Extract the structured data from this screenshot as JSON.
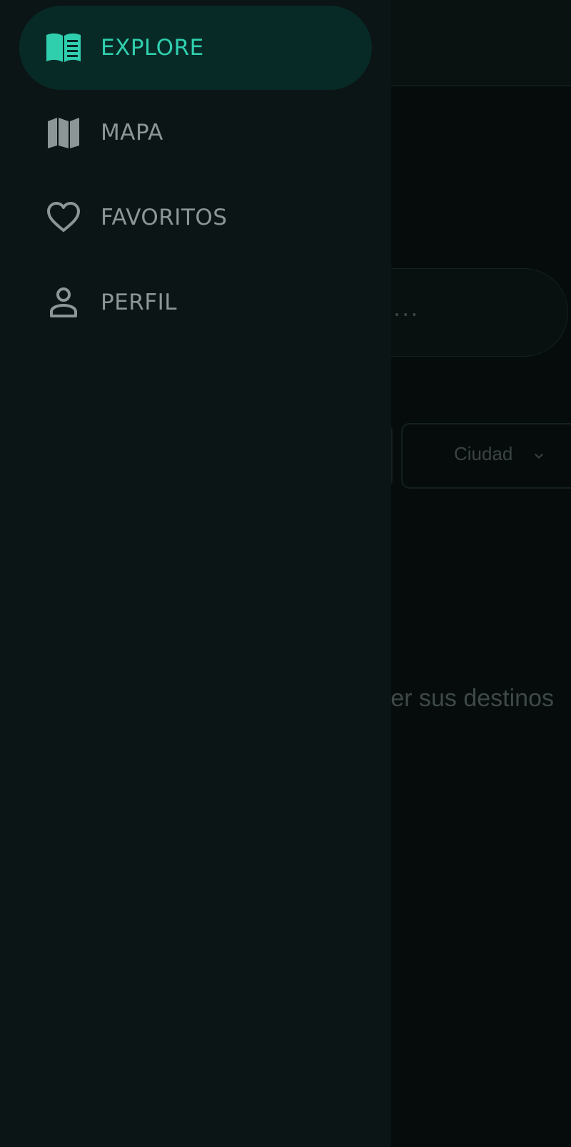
{
  "drawer": {
    "items": [
      {
        "label": "EXPLORE",
        "icon": "book-open-icon",
        "active": true
      },
      {
        "label": "MAPA",
        "icon": "map-icon",
        "active": false
      },
      {
        "label": "FAVORITOS",
        "icon": "heart-icon",
        "active": false
      },
      {
        "label": "PERFIL",
        "icon": "person-icon",
        "active": false
      }
    ]
  },
  "background": {
    "search": {
      "placeholder": "..."
    },
    "filters": {
      "city_label": "Ciudad"
    },
    "empty_message": "er sus destinos"
  },
  "colors": {
    "accent": "#2fcfae",
    "active_pill": "#082a27",
    "drawer_bg": "#0b1515",
    "inactive_text": "#8d9696"
  }
}
